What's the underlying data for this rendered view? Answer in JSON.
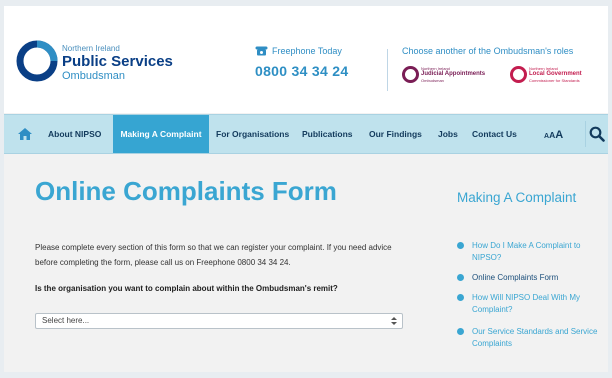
{
  "header": {
    "org": {
      "subtitle": "Northern Ireland",
      "title": "Public Services",
      "tagline": "Ombudsman"
    },
    "freephone": {
      "label": "Freephone Today",
      "number": "0800 34 34 24"
    },
    "roles": {
      "heading": "Choose another of the Ombudsman's roles",
      "items": [
        {
          "subtitle": "Northern Ireland",
          "title": "Judicial Appointments",
          "tagline": "Ombudsman"
        },
        {
          "subtitle": "Northern Ireland",
          "title": "Local Government",
          "tagline": "Commissioner for Standards"
        }
      ]
    }
  },
  "nav": {
    "items": [
      {
        "label": "About NIPSO"
      },
      {
        "label": "Making A Complaint"
      },
      {
        "label": "For Organisations"
      },
      {
        "label": "Publications"
      },
      {
        "label": "Our Findings"
      },
      {
        "label": "Jobs"
      },
      {
        "label": "Contact Us"
      }
    ],
    "active_index": 1,
    "text_size": [
      "A",
      "A",
      "A"
    ]
  },
  "main": {
    "title": "Online Complaints Form",
    "intro": "Please complete every section of this form so that we can register your complaint.  If you need advice before completing the form, please call us on Freephone 0800 34 34 24.",
    "question": "Is the organisation you want to complain about within the Ombudsman's remit?",
    "select": {
      "value": "Select here..."
    }
  },
  "sidebar": {
    "title": "Making A Complaint",
    "items": [
      {
        "label": "How Do I Make A Complaint to NIPSO?"
      },
      {
        "label": "Online Complaints Form"
      },
      {
        "label": "How Will NIPSO Deal With My Complaint?"
      },
      {
        "label": "Our Service Standards and Service Complaints"
      }
    ],
    "current_index": 1
  },
  "colors": {
    "brand_navy": "#0a3f86",
    "brand_blue": "#3aa6d2",
    "nav_bg": "#bfe2ed",
    "nav_active": "#36a5d2",
    "judicial": "#7a1d55",
    "local_gov": "#c31d4f"
  },
  "icons": {
    "nav_home": "home-icon",
    "phone": "phone-icon",
    "search": "search-icon",
    "select_arrow": "updown-arrow-icon",
    "bullet": "bullet-icon"
  }
}
